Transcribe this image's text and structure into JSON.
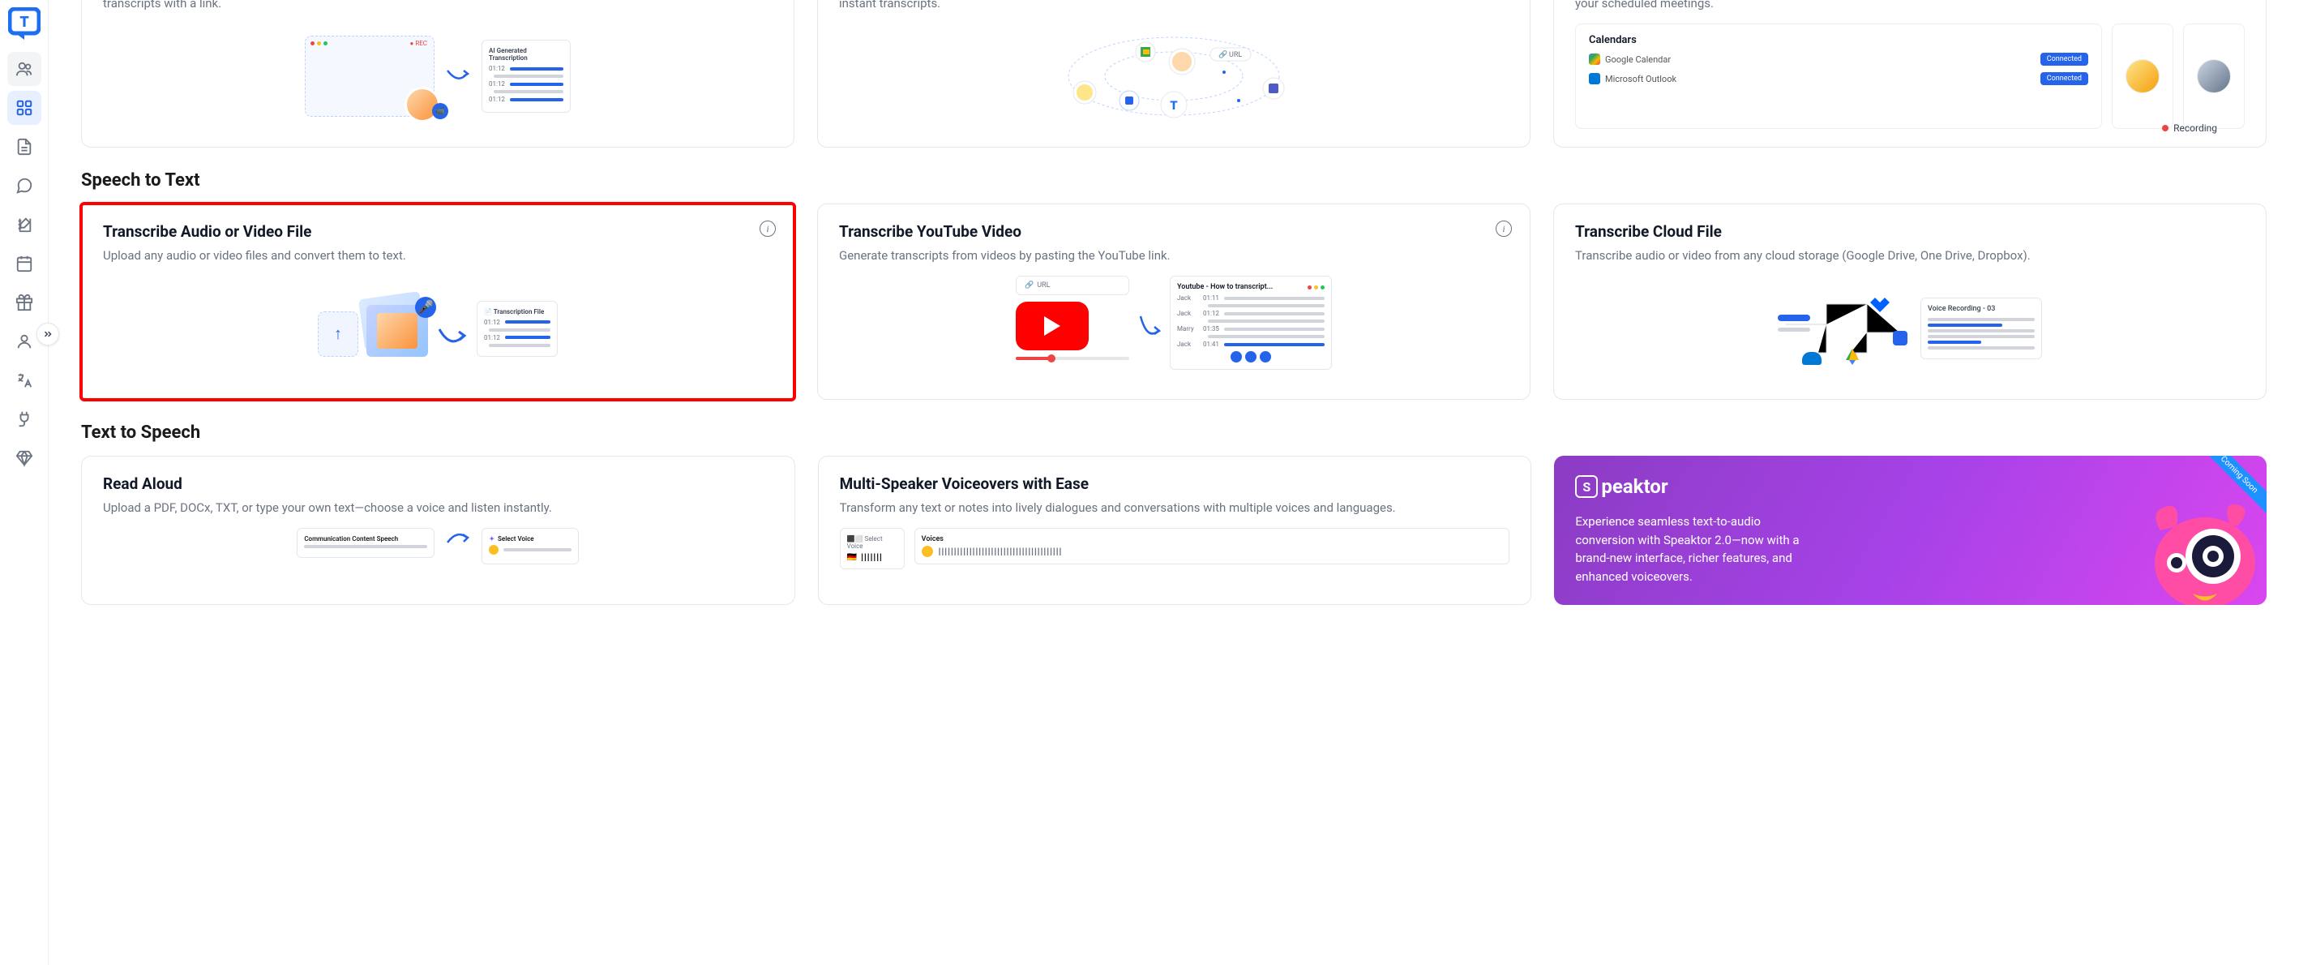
{
  "sidebar": {
    "logo_letter": "T"
  },
  "sections": {
    "speech_to_text": "Speech to Text",
    "text_to_speech": "Text to Speech"
  },
  "top_row": {
    "card1_desc_tail": "transcripts with a link.",
    "card1_illus": {
      "rec": "REC",
      "ai_title": "AI Generated Transcription",
      "t1": "01:12",
      "t2": "01:12",
      "t3": "01:12"
    },
    "card2_desc_tail": "instant transcripts.",
    "card2_url": "URL",
    "card3_desc_tail": "your scheduled meetings.",
    "card3_calendars": {
      "title": "Calendars",
      "google": "Google Calendar",
      "outlook": "Microsoft Outlook",
      "connected": "Connected",
      "recording": "Recording"
    }
  },
  "stt": {
    "file": {
      "title": "Transcribe Audio or Video File",
      "desc": "Upload any audio or video files and convert them to text.",
      "trans_file": "Transcription File",
      "t1": "01:12",
      "t2": "01:12"
    },
    "youtube": {
      "title": "Transcribe YouTube Video",
      "desc": "Generate transcripts from videos by pasting the YouTube link.",
      "url": "URL",
      "panel_title": "Youtube - How to transcript...",
      "rows": [
        {
          "name": "Jack",
          "time": "01:11"
        },
        {
          "name": "Jack",
          "time": "01:12"
        },
        {
          "name": "Marry",
          "time": "01:35"
        },
        {
          "name": "Jack",
          "time": "01:41"
        }
      ]
    },
    "cloud": {
      "title": "Transcribe Cloud File",
      "desc": "Transcribe audio or video from any cloud storage (Google Drive, One Drive, Dropbox).",
      "rec_title": "Voice Recording - 03"
    }
  },
  "tts": {
    "read": {
      "title": "Read Aloud",
      "desc": "Upload a PDF, DOCx, TXT, or type your own text—choose a voice and listen instantly.",
      "panel1": "Communication Content Speech",
      "panel2": "Select Voice"
    },
    "multi": {
      "title": "Multi-Speaker Voiceovers with Ease",
      "desc": "Transform any text or notes into lively dialogues and conversations with multiple voices and languages.",
      "select": "Select Voice",
      "voices": "Voices"
    },
    "promo": {
      "logo": "Speaktor",
      "desc": "Experience seamless text-to-audio conversion with Speaktor 2.0—now with a brand-new interface, richer features, and enhanced voiceovers.",
      "badge": "Coming Soon"
    }
  }
}
